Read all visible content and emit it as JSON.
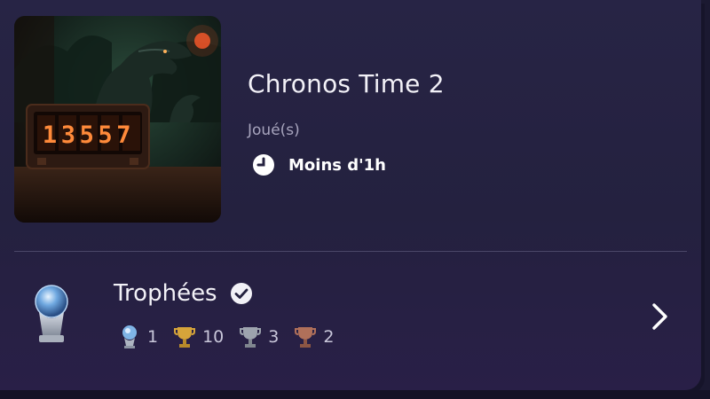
{
  "game": {
    "title": "Chronos Time 2",
    "cover_counter": "13557",
    "played_label": "Joué(s)",
    "playtime": "Moins d'1h"
  },
  "trophies": {
    "title": "Trophées",
    "platinum": "1",
    "gold": "10",
    "silver": "3",
    "bronze": "2"
  },
  "colors": {
    "background": "#24213f",
    "text": "#f2f1f7",
    "muted": "#a7a4bd",
    "gold": "#d6a43a",
    "silver": "#9ea4ae",
    "bronze": "#b0705a",
    "platinum": "#7fb4e6"
  },
  "icons": [
    "clock-icon",
    "verified-check-icon",
    "platinum-trophy-icon",
    "gold-trophy-icon",
    "silver-trophy-icon",
    "bronze-trophy-icon",
    "chevron-right-icon"
  ]
}
